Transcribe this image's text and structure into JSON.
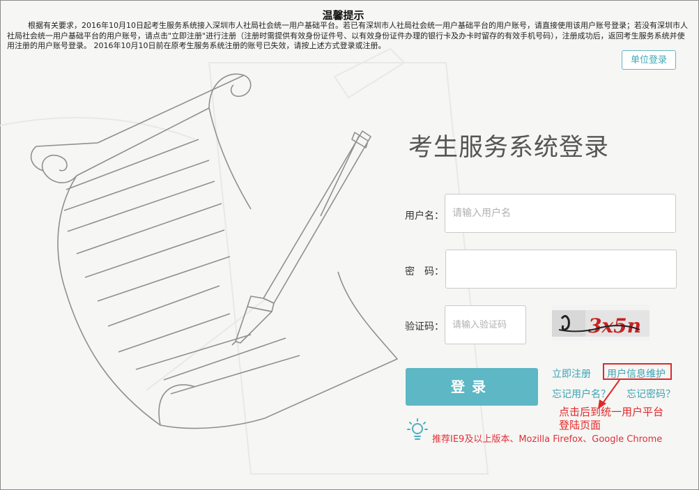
{
  "notice": {
    "title": "温馨提示",
    "body": "根据有关要求，2016年10月10日起考生服务系统接入深圳市人社局社会统一用户基础平台。若已有深圳市人社局社会统一用户基础平台的用户账号，请直接使用该用户账号登录；若没有深圳市人社局社会统一用户基础平台的用户账号，请点击\"立即注册\"进行注册（注册时需提供有效身份证件号、以有效身份证件办理的银行卡及办卡时留存的有效手机号码），注册成功后，返回考生服务系统并使用注册的用户账号登录。 2016年10月10日前在原考生服务系统注册的账号已失效，请按上述方式登录或注册。"
  },
  "unit_login_label": "单位登录",
  "login": {
    "title": "考生服务系统登录",
    "username_label": "用户名：",
    "username_placeholder": "请输入用户名",
    "password_label": "密　码：",
    "captcha_label": "验证码：",
    "captcha_placeholder": "请输入验证码",
    "captcha_text": "3x5n",
    "submit_label": "登录"
  },
  "links": {
    "register": "立即注册",
    "user_info": "用户信息维护",
    "forgot_username": "忘记用户名？",
    "forgot_password": "忘记密码？"
  },
  "annotation": {
    "line1": "点击后到统一用户平台",
    "line2": "登陆页面"
  },
  "browser_tip": "推荐IE9及以上版本、Mozilla Firefox、Google Chrome",
  "colors": {
    "accent": "#5db7c4",
    "annotation_red": "#e02828"
  },
  "icons": {
    "tip": "lightbulb-icon",
    "arrow": "annotation-arrow"
  }
}
